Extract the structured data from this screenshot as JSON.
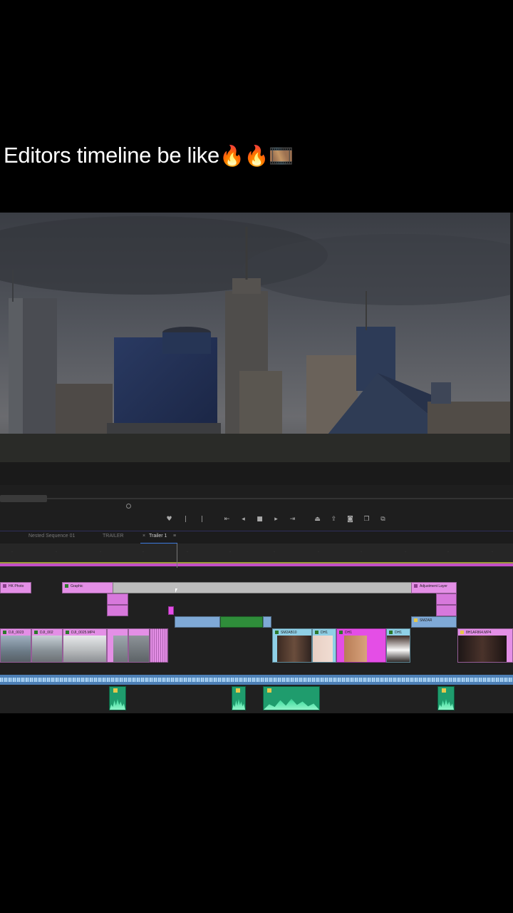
{
  "caption": {
    "text": "Editors timeline be like",
    "emoji": "🔥🔥🎞️"
  },
  "timeline": {
    "tabs": [
      "Nested Sequence 01",
      "TRAILER",
      "Trailer 1"
    ],
    "active_tab": "Trailer 1",
    "tab_menu_icon": "≡",
    "clips": {
      "v4_a": "HK Photo",
      "v4_b": "Graphic",
      "v4_c": "Adjustment Layer",
      "v2_end": "SMZAR",
      "v1": [
        "DJI_0023",
        "DJI_002",
        "DJI_0025.MP4",
        "SM2AB10",
        "DH1",
        "DH1",
        "DH1",
        "8H1AF864.MP4"
      ]
    }
  },
  "colors": {
    "graphic_clip": "#e48fe6",
    "adjustment_clip": "#bdbdbd",
    "nested_clip": "#7fa9d6",
    "audio_clip": "#1f9c6d",
    "work_area": "#c34ec7"
  }
}
